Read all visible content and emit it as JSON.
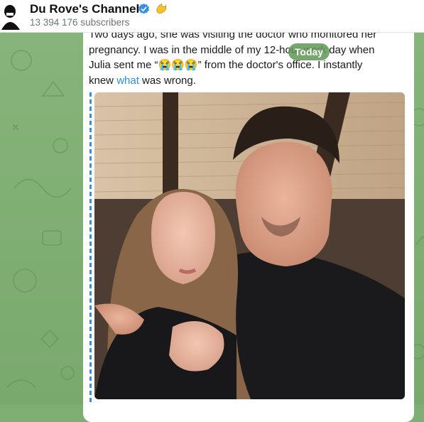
{
  "header": {
    "channel_name": "Du Rove's Channel",
    "subscribers": "13 394 176 subscribers",
    "verified_color": "#3a8fe0",
    "badge_color": "#f4c430"
  },
  "date_pill": {
    "label": "Today"
  },
  "message": {
    "line1": "Two days ago, she was visiting the doctor who monitored her",
    "line2": "pregnancy. I was in the middle of my 12-hour work day when",
    "line3a": "Julia sent me “",
    "emojis": "😭😭😭",
    "line3b": "” from the doctor's office. I instantly",
    "line4a": "knew ",
    "link_word": "what",
    "line4b": " was wrong."
  },
  "colors": {
    "chat_bg": "#7fae74",
    "link": "#2f8fd5",
    "quote_bar": "#3a8fd9"
  }
}
